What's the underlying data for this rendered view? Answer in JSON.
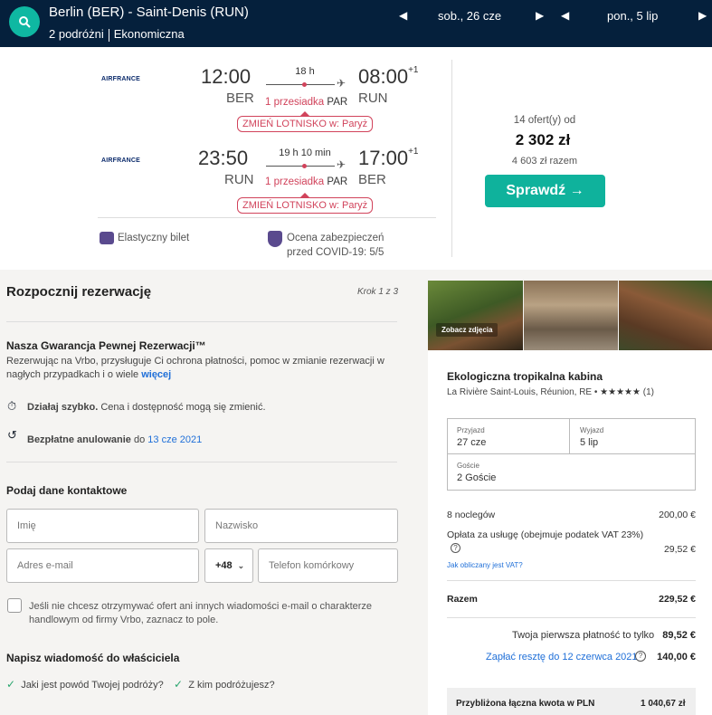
{
  "header": {
    "route": "Berlin (BER) - Saint-Denis (RUN)",
    "travellers": "2 podróżni",
    "cabin": "Ekonomiczna",
    "depart_date": "sob., 26 cze",
    "return_date": "pon., 5 lip"
  },
  "flights": [
    {
      "airline": "AIRFRANCE",
      "dep_time": "12:00",
      "dep_code": "BER",
      "duration": "18 h",
      "stops": "1 przesiadka",
      "via": "PAR",
      "arr_time": "08:00",
      "arr_day": "+1",
      "arr_code": "RUN",
      "airport_change": "ZMIEŃ LOTNISKO w: Paryż"
    },
    {
      "airline": "AIRFRANCE",
      "dep_time": "23:50",
      "dep_code": "RUN",
      "duration": "19 h 10 min",
      "stops": "1 przesiadka",
      "via": "PAR",
      "arr_time": "17:00",
      "arr_day": "+1",
      "arr_code": "BER",
      "airport_change": "ZMIEŃ LOTNISKO w: Paryż"
    }
  ],
  "features": {
    "flexible": "Elastyczny bilet",
    "covid_1": "Ocena zabezpieczeń",
    "covid_2": "przed COVID-19: 5/5"
  },
  "offer": {
    "offers": "14 ofert(y) od",
    "price": "2 302 zł",
    "total": "4 603 zł razem",
    "button": "Sprawdź →"
  },
  "booking": {
    "title": "Rozpocznij rezerwację",
    "step": "Krok 1 z 3",
    "guarantee_title": "Nasza Gwarancja Pewnej Rezerwacji™",
    "guarantee_text_1": "Rezerwując na Vrbo, przysługuje Ci ochrona płatności, pomoc w zmianie rezerwacji w",
    "guarantee_text_2": "nagłych przypadkach i o wiele",
    "more": "więcej",
    "fast_bold": "Działaj szybko.",
    "fast_text": "Cena i dostępność mogą się zmienić.",
    "cancel_bold": "Bezpłatne anulowanie",
    "cancel_text": "do",
    "cancel_date": "13 cze 2021",
    "contact_title": "Podaj dane kontaktowe",
    "first_name": "Imię",
    "last_name": "Nazwisko",
    "email": "Adres e-mail",
    "country_code": "+48",
    "phone": "Telefon komórkowy",
    "optout_1": "Jeśli nie chcesz otrzymywać ofert ani innych wiadomości e-mail o charakterze",
    "optout_2": "handlowym od firmy Vrbo, zaznacz to pole.",
    "message_title": "Napisz wiadomość do właściciela",
    "q1": "Jaki jest powód Twojej podróży?",
    "q2": "Z kim podróżujesz?"
  },
  "property": {
    "photos_label": "Zobacz zdjęcia",
    "name": "Ekologiczna tropikalna kabina",
    "location": "La Rivière Saint-Louis, Réunion, RE",
    "stars": "★★★★★",
    "reviews": "(1)",
    "arrival_label": "Przyjazd",
    "arrival": "27 cze",
    "departure_label": "Wyjazd",
    "departure": "5 lip",
    "guests_label": "Goście",
    "guests": "2 Goście",
    "nights": "8 noclegów",
    "nights_price": "200,00 €",
    "fee": "Opłata za usługę (obejmuje podatek VAT 23%)",
    "fee_price": "29,52 €",
    "vat_link": "Jak obliczany jest VAT?",
    "total_label": "Razem",
    "total_price": "229,52 €",
    "first_payment": "Twoja pierwsza płatność to tylko",
    "first_payment_price": "89,52 €",
    "rest": "Zapłać resztę do 12 czerwca 2021",
    "rest_price": "140,00 €",
    "approx": "Przybliżona łączna kwota w PLN",
    "approx_price": "1 040,67 zł"
  }
}
